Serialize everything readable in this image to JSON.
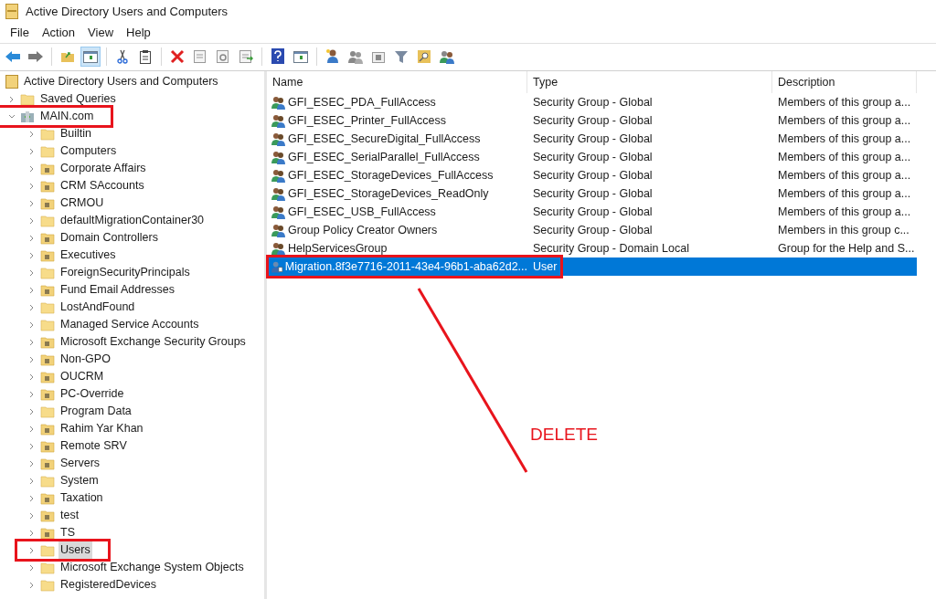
{
  "window": {
    "title": "Active Directory Users and Computers"
  },
  "menu": [
    "File",
    "Action",
    "View",
    "Help"
  ],
  "toolbar": [
    {
      "kind": "back",
      "pressed": false
    },
    {
      "kind": "forward",
      "pressed": false
    },
    {
      "kind": "sep"
    },
    {
      "kind": "up",
      "pressed": false
    },
    {
      "kind": "tree",
      "pressed": true
    },
    {
      "kind": "sep"
    },
    {
      "kind": "cut",
      "pressed": false
    },
    {
      "kind": "paste",
      "pressed": false
    },
    {
      "kind": "sep"
    },
    {
      "kind": "delete",
      "pressed": false
    },
    {
      "kind": "properties",
      "pressed": false
    },
    {
      "kind": "refresh",
      "pressed": false
    },
    {
      "kind": "export",
      "pressed": false
    },
    {
      "kind": "sep"
    },
    {
      "kind": "help",
      "pressed": false
    },
    {
      "kind": "pane",
      "pressed": false
    },
    {
      "kind": "sep"
    },
    {
      "kind": "user",
      "pressed": false
    },
    {
      "kind": "group",
      "pressed": false
    },
    {
      "kind": "ou",
      "pressed": false
    },
    {
      "kind": "filter",
      "pressed": false
    },
    {
      "kind": "find",
      "pressed": false
    },
    {
      "kind": "addgroup",
      "pressed": false
    }
  ],
  "tree": {
    "label": "Active Directory Users and Computers",
    "children": [
      {
        "label": "Saved Queries",
        "kind": "container",
        "expanded": false,
        "selected": false,
        "annotated": false
      },
      {
        "label": "MAIN.com",
        "kind": "domain",
        "expanded": true,
        "selected": false,
        "annotated": true,
        "children": [
          {
            "label": "Builtin",
            "kind": "container",
            "expanded": false,
            "selected": false,
            "annotated": false
          },
          {
            "label": "Computers",
            "kind": "container",
            "expanded": false,
            "selected": false,
            "annotated": false
          },
          {
            "label": "Corporate Affairs",
            "kind": "ou",
            "expanded": false,
            "selected": false,
            "annotated": false
          },
          {
            "label": "CRM SAccounts",
            "kind": "ou",
            "expanded": false,
            "selected": false,
            "annotated": false
          },
          {
            "label": "CRMOU",
            "kind": "ou",
            "expanded": false,
            "selected": false,
            "annotated": false
          },
          {
            "label": "defaultMigrationContainer30",
            "kind": "container",
            "expanded": false,
            "selected": false,
            "annotated": false
          },
          {
            "label": "Domain Controllers",
            "kind": "ou",
            "expanded": false,
            "selected": false,
            "annotated": false
          },
          {
            "label": "Executives",
            "kind": "ou",
            "expanded": false,
            "selected": false,
            "annotated": false
          },
          {
            "label": "ForeignSecurityPrincipals",
            "kind": "container",
            "expanded": false,
            "selected": false,
            "annotated": false
          },
          {
            "label": "Fund Email Addresses",
            "kind": "ou",
            "expanded": false,
            "selected": false,
            "annotated": false
          },
          {
            "label": "LostAndFound",
            "kind": "container",
            "expanded": false,
            "selected": false,
            "annotated": false
          },
          {
            "label": "Managed Service Accounts",
            "kind": "container",
            "expanded": false,
            "selected": false,
            "annotated": false
          },
          {
            "label": "Microsoft Exchange Security Groups",
            "kind": "ou",
            "expanded": false,
            "selected": false,
            "annotated": false
          },
          {
            "label": "Non-GPO",
            "kind": "ou",
            "expanded": false,
            "selected": false,
            "annotated": false
          },
          {
            "label": "OUCRM",
            "kind": "ou",
            "expanded": false,
            "selected": false,
            "annotated": false
          },
          {
            "label": "PC-Override",
            "kind": "ou",
            "expanded": false,
            "selected": false,
            "annotated": false
          },
          {
            "label": "Program Data",
            "kind": "container",
            "expanded": false,
            "selected": false,
            "annotated": false
          },
          {
            "label": "Rahim Yar Khan",
            "kind": "ou",
            "expanded": false,
            "selected": false,
            "annotated": false
          },
          {
            "label": "Remote SRV",
            "kind": "ou",
            "expanded": false,
            "selected": false,
            "annotated": false
          },
          {
            "label": "Servers",
            "kind": "ou",
            "expanded": false,
            "selected": false,
            "annotated": false
          },
          {
            "label": "System",
            "kind": "container",
            "expanded": false,
            "selected": false,
            "annotated": false
          },
          {
            "label": "Taxation",
            "kind": "ou",
            "expanded": false,
            "selected": false,
            "annotated": false
          },
          {
            "label": "test",
            "kind": "ou",
            "expanded": false,
            "selected": false,
            "annotated": false
          },
          {
            "label": "TS",
            "kind": "ou",
            "expanded": false,
            "selected": false,
            "annotated": false
          },
          {
            "label": "Users",
            "kind": "container",
            "expanded": false,
            "selected": true,
            "annotated": true
          },
          {
            "label": "Microsoft Exchange System Objects",
            "kind": "container",
            "expanded": false,
            "selected": false,
            "annotated": false
          },
          {
            "label": "RegisteredDevices",
            "kind": "container",
            "expanded": false,
            "selected": false,
            "annotated": false
          }
        ]
      }
    ]
  },
  "table": {
    "columns": [
      "Name",
      "Type",
      "Description"
    ],
    "rows": [
      {
        "kind": "group",
        "name": "GFI_ESEC_PDA_FullAccess",
        "type": "Security Group - Global",
        "description": "Members of this group a...",
        "selected": false,
        "annotated": false
      },
      {
        "kind": "group",
        "name": "GFI_ESEC_Printer_FullAccess",
        "type": "Security Group - Global",
        "description": "Members of this group a...",
        "selected": false,
        "annotated": false
      },
      {
        "kind": "group",
        "name": "GFI_ESEC_SecureDigital_FullAccess",
        "type": "Security Group - Global",
        "description": "Members of this group a...",
        "selected": false,
        "annotated": false
      },
      {
        "kind": "group",
        "name": "GFI_ESEC_SerialParallel_FullAccess",
        "type": "Security Group - Global",
        "description": "Members of this group a...",
        "selected": false,
        "annotated": false
      },
      {
        "kind": "group",
        "name": "GFI_ESEC_StorageDevices_FullAccess",
        "type": "Security Group - Global",
        "description": "Members of this group a...",
        "selected": false,
        "annotated": false
      },
      {
        "kind": "group",
        "name": "GFI_ESEC_StorageDevices_ReadOnly",
        "type": "Security Group - Global",
        "description": "Members of this group a...",
        "selected": false,
        "annotated": false
      },
      {
        "kind": "group",
        "name": "GFI_ESEC_USB_FullAccess",
        "type": "Security Group - Global",
        "description": "Members of this group a...",
        "selected": false,
        "annotated": false
      },
      {
        "kind": "group",
        "name": "Group Policy Creator Owners",
        "type": "Security Group - Global",
        "description": "Members in this group c...",
        "selected": false,
        "annotated": false
      },
      {
        "kind": "group",
        "name": "HelpServicesGroup",
        "type": "Security Group - Domain Local",
        "description": "Group for the Help and S...",
        "selected": false,
        "annotated": false
      },
      {
        "kind": "user",
        "name": "Migration.8f3e7716-2011-43e4-96b1-aba62d2...",
        "type": "User",
        "description": "",
        "selected": true,
        "annotated": true
      }
    ]
  },
  "annotation": {
    "label": "DELETE"
  }
}
